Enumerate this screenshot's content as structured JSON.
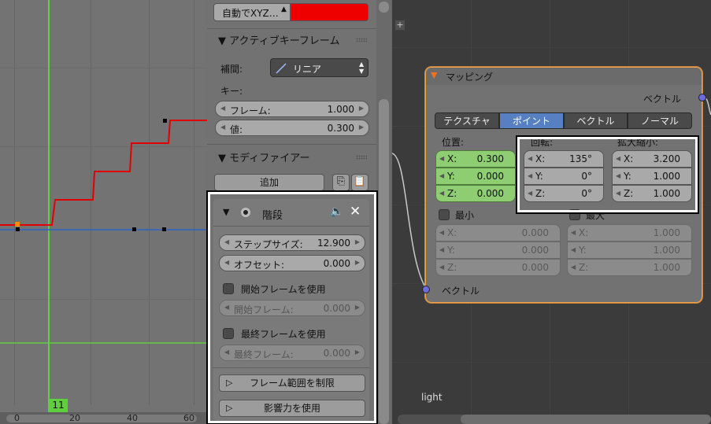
{
  "graph": {
    "ruler_labels": [
      "0",
      "20",
      "40",
      "60"
    ],
    "current_frame": "11"
  },
  "props": {
    "axis_mode": "自動でXYZ…",
    "active_keyframe": {
      "header": "▼ アクティブキーフレーム",
      "interp_label": "補間:",
      "interp_value": "リニア",
      "key_label": "キー:",
      "frame_label": "フレーム:",
      "frame_value": "1.000",
      "value_label": "値:",
      "value_value": "0.300"
    },
    "modifiers": {
      "header": "▼ モディファイアー",
      "add_button": "追加"
    },
    "stepped": {
      "title": "階段",
      "step_size_label": "ステップサイズ:",
      "step_size_value": "12.900",
      "offset_label": "オフセット:",
      "offset_value": "0.000",
      "use_start_label": "開始フレームを使用",
      "start_frame_label": "開始フレーム:",
      "start_frame_value": "0.000",
      "use_end_label": "最終フレームを使用",
      "end_frame_label": "最終フレーム:",
      "end_frame_value": "0.000",
      "restrict_range_button": "フレーム範囲を制限",
      "use_influence_button": "影響力を使用"
    }
  },
  "node": {
    "title": "マッピング",
    "vector_out_label": "ベクトル",
    "vector_in_label": "ベクトル",
    "tabs": [
      "テクスチャ",
      "ポイント",
      "ベクトル",
      "ノーマル"
    ],
    "active_tab": "ポイント",
    "location_label": "位置:",
    "rotation_label": "回転:",
    "scale_label": "拡大縮小:",
    "location": {
      "x": "0.300",
      "y": "0.000",
      "z": "0.000"
    },
    "rotation": {
      "x": "135°",
      "y": "0°",
      "z": "0°"
    },
    "scale": {
      "x": "3.200",
      "y": "1.000",
      "z": "1.000"
    },
    "min_label": "最小",
    "max_label": "最大",
    "min": {
      "x": "0.000",
      "y": "0.000",
      "z": "0.000"
    },
    "max": {
      "x": "1.000",
      "y": "1.000",
      "z": "1.000"
    },
    "axis_x": "X:",
    "axis_y": "Y:",
    "axis_z": "Z:"
  },
  "footer_label": "light",
  "colors": {
    "accent_red": "#ee0000",
    "frame_green": "#5fcf3d",
    "active_tab": "#5680c2",
    "location_green": "#8fcd73",
    "node_border": "#f0a24a",
    "highlight": "#ffffff"
  }
}
